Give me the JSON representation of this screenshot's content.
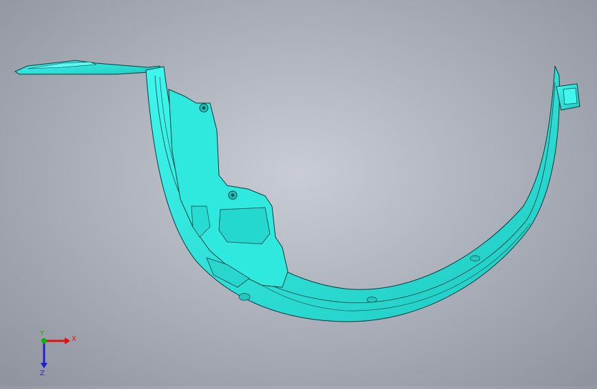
{
  "viewport": {
    "part_name": "fender-liner",
    "part_color": "#33f0e6",
    "part_shadow_color": "#18b8b0",
    "edge_color": "#0a3a3a"
  },
  "triad": {
    "x_label": "X",
    "y_label": "Y",
    "z_label": "Z",
    "x_color": "#e01010",
    "y_color": "#10b010",
    "z_color": "#2020d0"
  }
}
